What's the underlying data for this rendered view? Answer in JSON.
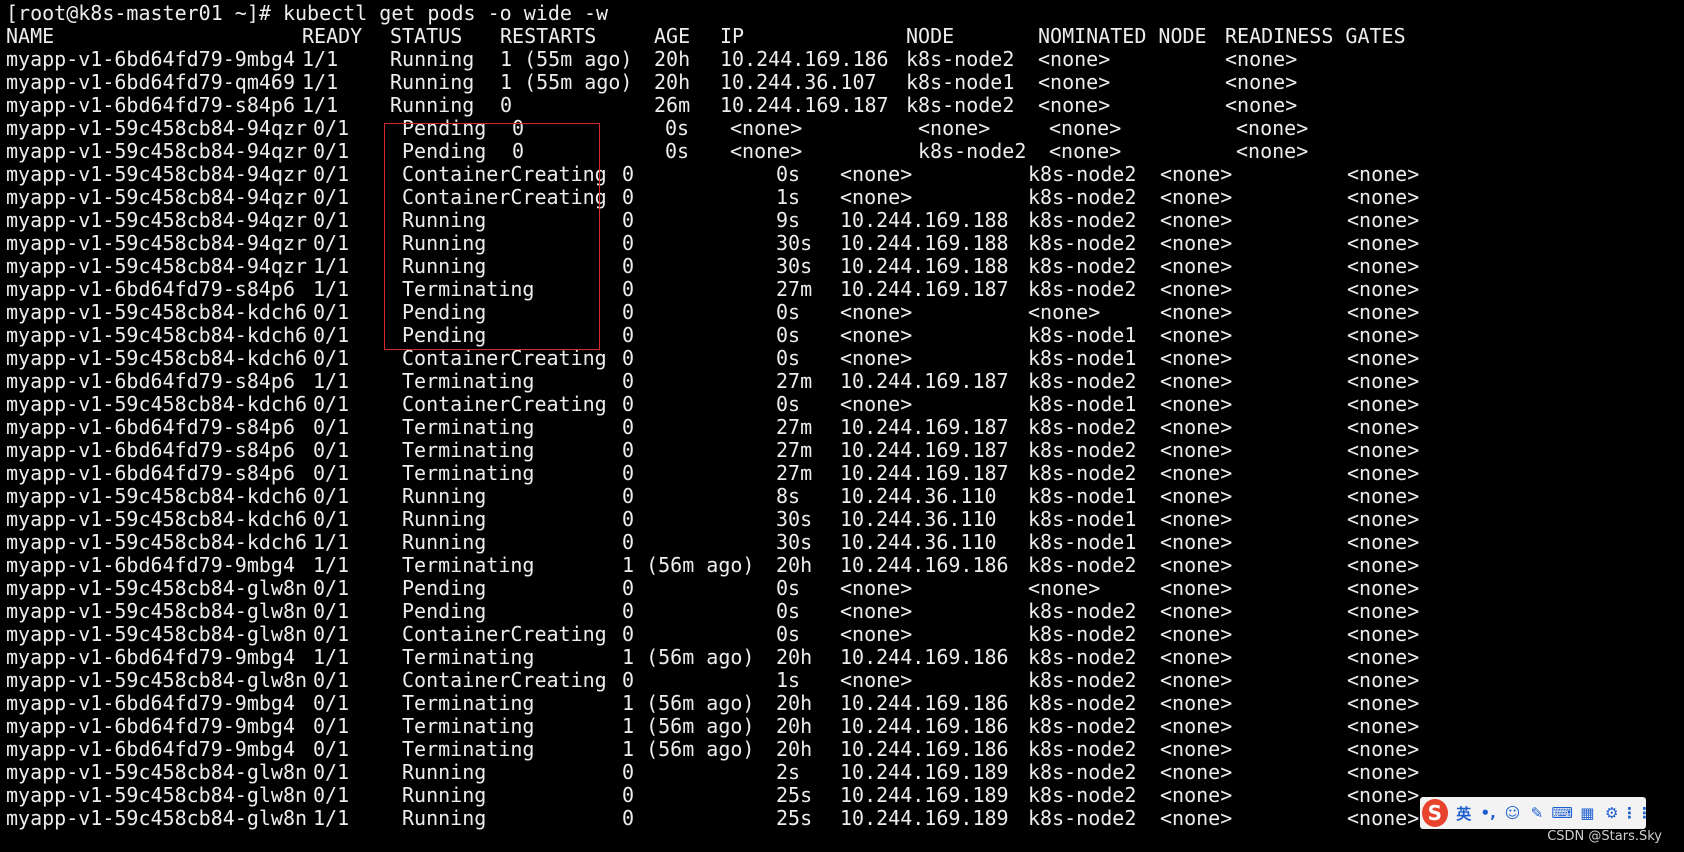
{
  "prompt": "[root@k8s-master01 ~]# kubectl get pods -o wide -w",
  "columns": [
    "NAME",
    "READY",
    "STATUS",
    "RESTARTS",
    "AGE",
    "IP",
    "NODE",
    "NOMINATED NODE",
    "READINESS GATES"
  ],
  "rows": [
    [
      "myapp-v1-6bd64fd79-9mbg4",
      "1/1",
      "Running",
      "1 (55m ago)",
      "20h",
      "10.244.169.186",
      "k8s-node2",
      "<none>",
      "<none>"
    ],
    [
      "myapp-v1-6bd64fd79-qm469",
      "1/1",
      "Running",
      "1 (55m ago)",
      "20h",
      "10.244.36.107",
      "k8s-node1",
      "<none>",
      "<none>"
    ],
    [
      "myapp-v1-6bd64fd79-s84p6",
      "1/1",
      "Running",
      "0",
      "26m",
      "10.244.169.187",
      "k8s-node2",
      "<none>",
      "<none>"
    ],
    [
      "myapp-v1-59c458cb84-94qzr",
      "0/1",
      "Pending",
      "0",
      "0s",
      "<none>",
      "<none>",
      "<none>",
      "<none>"
    ],
    [
      "myapp-v1-59c458cb84-94qzr",
      "0/1",
      "Pending",
      "0",
      "0s",
      "<none>",
      "k8s-node2",
      "<none>",
      "<none>"
    ],
    [
      "myapp-v1-59c458cb84-94qzr",
      "0/1",
      "ContainerCreating",
      "0",
      "0s",
      "<none>",
      "k8s-node2",
      "<none>",
      "<none>"
    ],
    [
      "myapp-v1-59c458cb84-94qzr",
      "0/1",
      "ContainerCreating",
      "0",
      "1s",
      "<none>",
      "k8s-node2",
      "<none>",
      "<none>"
    ],
    [
      "myapp-v1-59c458cb84-94qzr",
      "0/1",
      "Running",
      "0",
      "9s",
      "10.244.169.188",
      "k8s-node2",
      "<none>",
      "<none>"
    ],
    [
      "myapp-v1-59c458cb84-94qzr",
      "0/1",
      "Running",
      "0",
      "30s",
      "10.244.169.188",
      "k8s-node2",
      "<none>",
      "<none>"
    ],
    [
      "myapp-v1-59c458cb84-94qzr",
      "1/1",
      "Running",
      "0",
      "30s",
      "10.244.169.188",
      "k8s-node2",
      "<none>",
      "<none>"
    ],
    [
      "myapp-v1-6bd64fd79-s84p6",
      "1/1",
      "Terminating",
      "0",
      "27m",
      "10.244.169.187",
      "k8s-node2",
      "<none>",
      "<none>"
    ],
    [
      "myapp-v1-59c458cb84-kdch6",
      "0/1",
      "Pending",
      "0",
      "0s",
      "<none>",
      "<none>",
      "<none>",
      "<none>"
    ],
    [
      "myapp-v1-59c458cb84-kdch6",
      "0/1",
      "Pending",
      "0",
      "0s",
      "<none>",
      "k8s-node1",
      "<none>",
      "<none>"
    ],
    [
      "myapp-v1-59c458cb84-kdch6",
      "0/1",
      "ContainerCreating",
      "0",
      "0s",
      "<none>",
      "k8s-node1",
      "<none>",
      "<none>"
    ],
    [
      "myapp-v1-6bd64fd79-s84p6",
      "1/1",
      "Terminating",
      "0",
      "27m",
      "10.244.169.187",
      "k8s-node2",
      "<none>",
      "<none>"
    ],
    [
      "myapp-v1-59c458cb84-kdch6",
      "0/1",
      "ContainerCreating",
      "0",
      "0s",
      "<none>",
      "k8s-node1",
      "<none>",
      "<none>"
    ],
    [
      "myapp-v1-6bd64fd79-s84p6",
      "0/1",
      "Terminating",
      "0",
      "27m",
      "10.244.169.187",
      "k8s-node2",
      "<none>",
      "<none>"
    ],
    [
      "myapp-v1-6bd64fd79-s84p6",
      "0/1",
      "Terminating",
      "0",
      "27m",
      "10.244.169.187",
      "k8s-node2",
      "<none>",
      "<none>"
    ],
    [
      "myapp-v1-6bd64fd79-s84p6",
      "0/1",
      "Terminating",
      "0",
      "27m",
      "10.244.169.187",
      "k8s-node2",
      "<none>",
      "<none>"
    ],
    [
      "myapp-v1-59c458cb84-kdch6",
      "0/1",
      "Running",
      "0",
      "8s",
      "10.244.36.110",
      "k8s-node1",
      "<none>",
      "<none>"
    ],
    [
      "myapp-v1-59c458cb84-kdch6",
      "0/1",
      "Running",
      "0",
      "30s",
      "10.244.36.110",
      "k8s-node1",
      "<none>",
      "<none>"
    ],
    [
      "myapp-v1-59c458cb84-kdch6",
      "1/1",
      "Running",
      "0",
      "30s",
      "10.244.36.110",
      "k8s-node1",
      "<none>",
      "<none>"
    ],
    [
      "myapp-v1-6bd64fd79-9mbg4",
      "1/1",
      "Terminating",
      "1 (56m ago)",
      "20h",
      "10.244.169.186",
      "k8s-node2",
      "<none>",
      "<none>"
    ],
    [
      "myapp-v1-59c458cb84-glw8n",
      "0/1",
      "Pending",
      "0",
      "0s",
      "<none>",
      "<none>",
      "<none>",
      "<none>"
    ],
    [
      "myapp-v1-59c458cb84-glw8n",
      "0/1",
      "Pending",
      "0",
      "0s",
      "<none>",
      "k8s-node2",
      "<none>",
      "<none>"
    ],
    [
      "myapp-v1-59c458cb84-glw8n",
      "0/1",
      "ContainerCreating",
      "0",
      "0s",
      "<none>",
      "k8s-node2",
      "<none>",
      "<none>"
    ],
    [
      "myapp-v1-6bd64fd79-9mbg4",
      "1/1",
      "Terminating",
      "1 (56m ago)",
      "20h",
      "10.244.169.186",
      "k8s-node2",
      "<none>",
      "<none>"
    ],
    [
      "myapp-v1-59c458cb84-glw8n",
      "0/1",
      "ContainerCreating",
      "0",
      "1s",
      "<none>",
      "k8s-node2",
      "<none>",
      "<none>"
    ],
    [
      "myapp-v1-6bd64fd79-9mbg4",
      "0/1",
      "Terminating",
      "1 (56m ago)",
      "20h",
      "10.244.169.186",
      "k8s-node2",
      "<none>",
      "<none>"
    ],
    [
      "myapp-v1-6bd64fd79-9mbg4",
      "0/1",
      "Terminating",
      "1 (56m ago)",
      "20h",
      "10.244.169.186",
      "k8s-node2",
      "<none>",
      "<none>"
    ],
    [
      "myapp-v1-6bd64fd79-9mbg4",
      "0/1",
      "Terminating",
      "1 (56m ago)",
      "20h",
      "10.244.169.186",
      "k8s-node2",
      "<none>",
      "<none>"
    ],
    [
      "myapp-v1-59c458cb84-glw8n",
      "0/1",
      "Running",
      "0",
      "2s",
      "10.244.169.189",
      "k8s-node2",
      "<none>",
      "<none>"
    ],
    [
      "myapp-v1-59c458cb84-glw8n",
      "0/1",
      "Running",
      "0",
      "25s",
      "10.244.169.189",
      "k8s-node2",
      "<none>",
      "<none>"
    ],
    [
      "myapp-v1-59c458cb84-glw8n",
      "1/1",
      "Running",
      "0",
      "25s",
      "10.244.169.189",
      "k8s-node2",
      "<none>",
      "<none>"
    ]
  ],
  "ime_toolbar": {
    "logo": "S",
    "items": [
      "英",
      "•,",
      "☺",
      "✎",
      "⌨",
      "▦",
      "⚙",
      "⋮⋮"
    ]
  },
  "watermark": "CSDN @Stars.Sky",
  "colors": {
    "terminal_bg": "#000000",
    "terminal_fg": "#ededed",
    "highlight": "#d42a2a",
    "ime_logo": "#e8432c",
    "ime_icon": "#1e5fcf"
  }
}
